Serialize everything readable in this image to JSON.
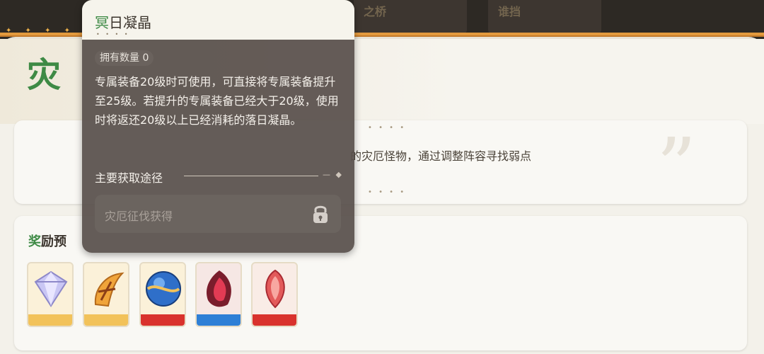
{
  "top_tabs": [
    "之桥",
    "谁挡"
  ],
  "panel": {
    "title_glyph": "灾",
    "description": "的灾厄怪物，通过调整阵容寻找弱点",
    "reward_title_accent": "奖",
    "reward_title_rest": "励预"
  },
  "items": [
    {
      "icon": "diamond-crystal-icon",
      "bar_color": "#f2c25a"
    },
    {
      "icon": "orange-horn-icon",
      "bar_color": "#f2c25a"
    },
    {
      "icon": "blue-orb-icon",
      "bar_color": "#d9322d"
    },
    {
      "icon": "red-crystal-flame-icon",
      "bar_color": "#2e7fd6"
    },
    {
      "icon": "red-gem-icon",
      "bar_color": "#d9322d"
    }
  ],
  "tooltip": {
    "name_accent": "冥",
    "name_rest": "日凝晶",
    "owned_label": "拥有数量 0",
    "description": "专属装备20级时可使用，可直接将专属装备提升至25级。若提升的专属装备已经大于20级，使用时将返还20级以上已经消耗的落日凝晶。",
    "source_label": "主要获取途径",
    "source_button": "灾厄征伐获得"
  },
  "colors": {
    "accent_green": "#3e8a45",
    "orange": "#e39a3e"
  }
}
